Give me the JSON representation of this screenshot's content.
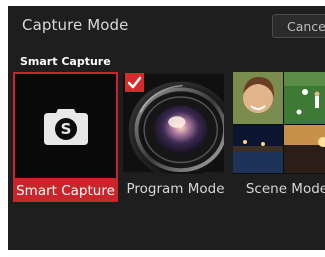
{
  "header": {
    "title": "Capture Mode",
    "cancel_label": "Cancel"
  },
  "section": {
    "label": "Smart Capture"
  },
  "modes": [
    {
      "label": "Smart Capture",
      "icon": "camera-icon",
      "selected": true
    },
    {
      "label": "Program Mode",
      "icon": "lens-icon",
      "checked": true
    },
    {
      "label": "Scene Modes",
      "icon": "scene-collage"
    }
  ],
  "colors": {
    "background": "#1e1e1e",
    "accent": "#c8262a",
    "text": "#d8d8d8"
  }
}
